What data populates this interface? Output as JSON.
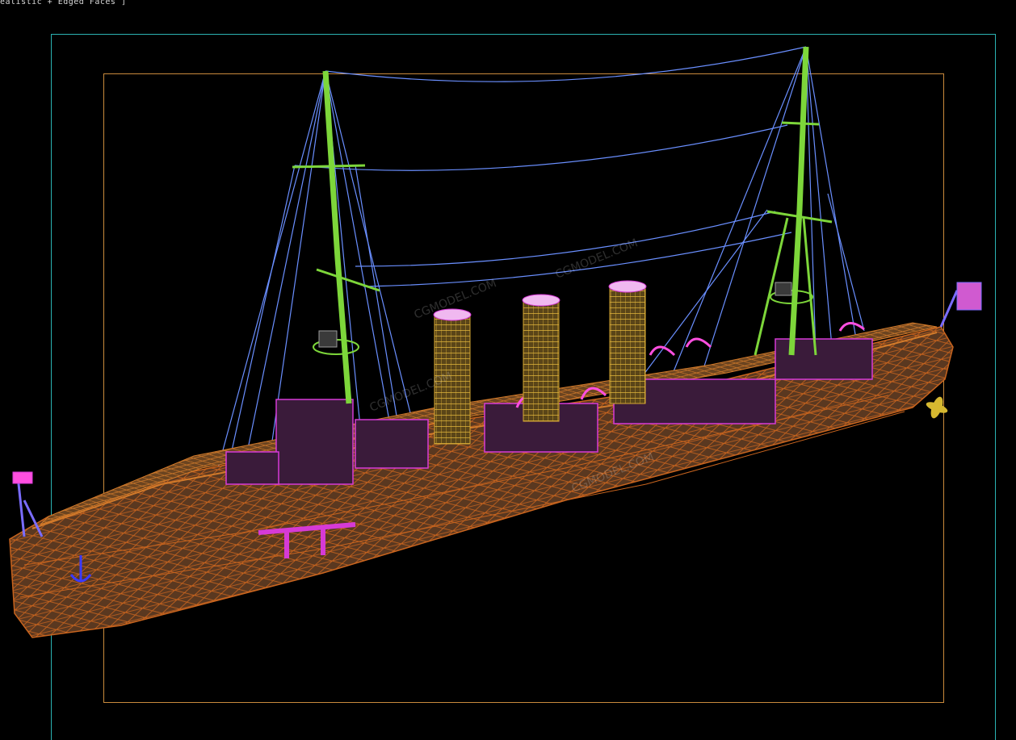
{
  "viewport": {
    "label": "ealistic + Edged Faces ]",
    "background": "#000000"
  },
  "safe_frames": {
    "outer_color": "#2bb3b3",
    "inner_color": "#c98a3c"
  },
  "model": {
    "wire_colors": {
      "hull": "#c8641e",
      "rigging": "#6a8fff",
      "masts": "#7dd63a",
      "funnels": "#d6a832",
      "superstructure": "#d63ad6",
      "boats": "#ff4fe0",
      "flags": "#7a6cff"
    }
  },
  "watermark": {
    "text": "CGMODEL.COM"
  },
  "icons": [
    "anchor-icon",
    "propeller-icon",
    "flag-icon"
  ]
}
